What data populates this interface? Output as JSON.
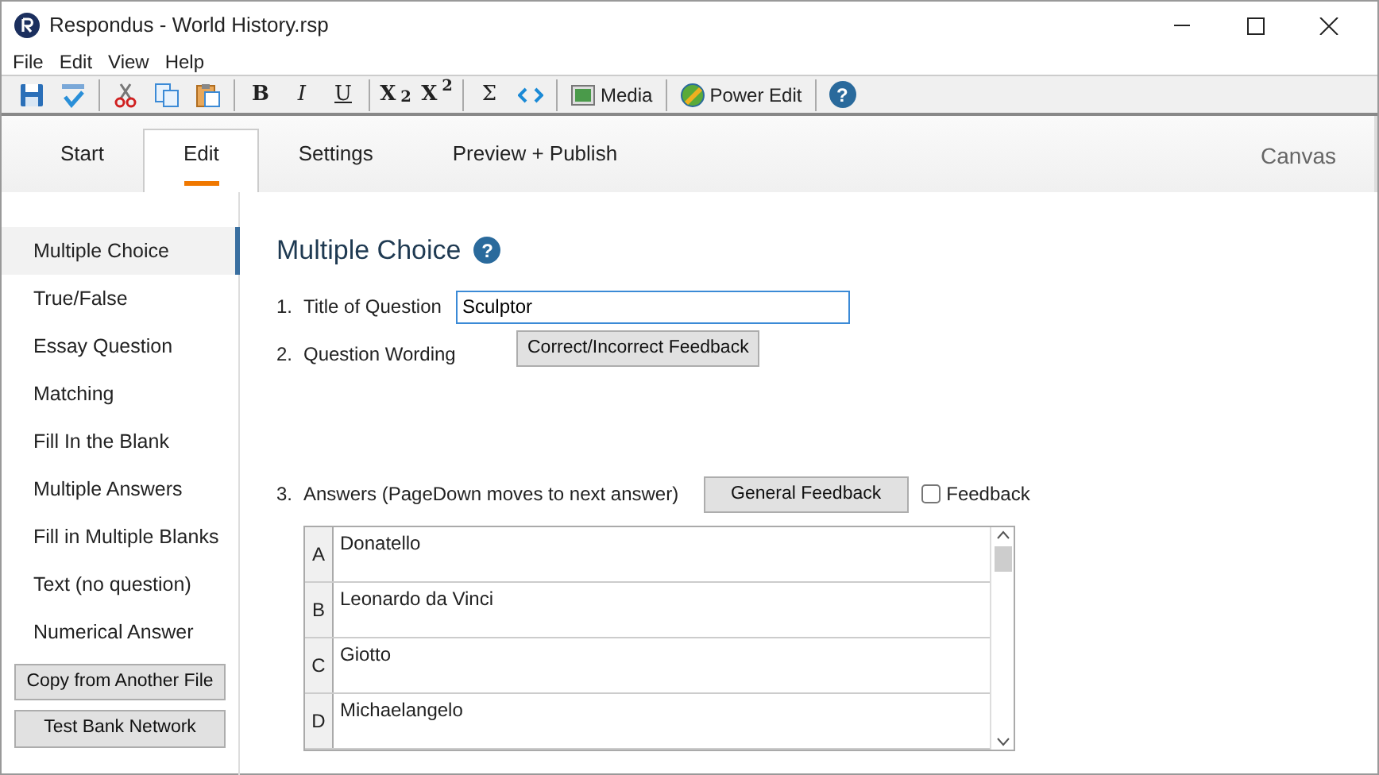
{
  "window": {
    "title": "Respondus - World History.rsp"
  },
  "menu": [
    "File",
    "Edit",
    "View",
    "Help"
  ],
  "toolbar": [
    [
      {
        "kind": "icon"
      },
      {
        "kind": "icon"
      }
    ],
    [
      {
        "kind": "icon"
      },
      {
        "kind": "icon"
      },
      {
        "kind": "icon"
      }
    ],
    [
      {
        "kind": "glyph",
        "label": "B"
      },
      {
        "kind": "glyph",
        "label": "I"
      },
      {
        "kind": "glyph",
        "label": "U"
      }
    ],
    [
      {
        "kind": "glyph",
        "label": "X$_{2}$"
      },
      {
        "kind": "glyph",
        "label": "X$^{2}$"
      }
    ],
    [
      {
        "kind": "glyph",
        "label": "Σ"
      },
      {
        "kind": "icon"
      }
    ],
    [
      {
        "kind": "labeled",
        "label": "Media"
      }
    ],
    [
      {
        "kind": "labeled",
        "label": "Power Edit"
      }
    ],
    [
      {
        "kind": "help",
        "label": "?"
      }
    ]
  ],
  "tabs": [
    {
      "label": "Start",
      "selected": false
    },
    {
      "label": "Edit",
      "selected": true
    },
    {
      "label": "Settings",
      "selected": false
    },
    {
      "label": "Preview + Publish",
      "selected": false
    }
  ],
  "lms": "Canvas",
  "sidebar": {
    "items": [
      {
        "label": "Multiple Choice",
        "selected": true
      },
      {
        "label": "True/False",
        "selected": false
      },
      {
        "label": "Essay Question",
        "selected": false
      },
      {
        "label": "Matching",
        "selected": false
      },
      {
        "label": "Fill In the Blank",
        "selected": false
      },
      {
        "label": "Multiple Answers",
        "selected": false
      },
      {
        "label": "Fill in Multiple Blanks",
        "selected": false
      },
      {
        "label": "Text (no question)",
        "selected": false
      },
      {
        "label": "Numerical Answer",
        "selected": false
      }
    ],
    "buttons": [
      "Copy from Another File",
      "Test Bank Network"
    ]
  },
  "editor": {
    "heading": "Multiple Choice",
    "help": "?",
    "title_field": {
      "number": "1.",
      "label": "Title of Question",
      "value": "Sculptor"
    },
    "wording": {
      "number": "2.",
      "label": "Question Wording",
      "button": "Correct/Incorrect Feedback"
    },
    "answers": {
      "number": "3.",
      "label": "Answers  (PageDown moves to next answer)",
      "button": "General Feedback",
      "checkbox": {
        "label": "Feedback",
        "checked": false
      },
      "rows": [
        {
          "letter": "A",
          "text": "Donatello"
        },
        {
          "letter": "B",
          "text": "Leonardo da Vinci"
        },
        {
          "letter": "C",
          "text": "Giotto"
        },
        {
          "letter": "D",
          "text": "Michaelangelo"
        }
      ]
    }
  }
}
